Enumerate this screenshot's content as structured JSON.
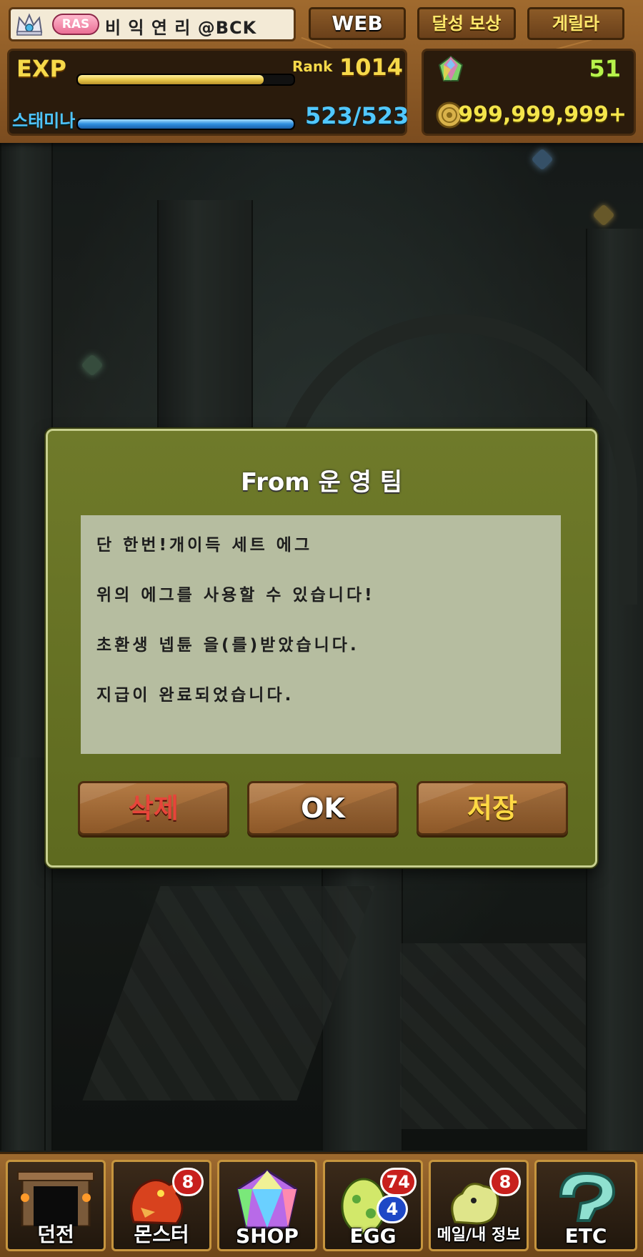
{
  "header": {
    "player_badge": "RAS",
    "player_name": "비 익 연 리 @BCK",
    "tabs": {
      "web": "WEB",
      "achievement": "달성 보상",
      "guerrilla": "게릴라"
    },
    "exp_label": "EXP",
    "exp_progress": 0.86,
    "rank_label": "Rank",
    "rank_value": "1014",
    "stamina_label": "스태미나",
    "stamina_value": "523/523",
    "stamina_progress": 1.0,
    "magic_stones": "51",
    "coins": "999,999,999+"
  },
  "dialog": {
    "title": "From 운 영 팀",
    "lines": [
      "단 한번!개이득 세트 에그",
      "위의 에그를 사용할 수 있습니다!",
      "초환생 넵튠 을(를)받았습니다.",
      "지급이 완료되었습니다."
    ],
    "buttons": {
      "delete": "삭제",
      "ok": "OK",
      "save": "저장"
    }
  },
  "nav": {
    "items": [
      {
        "label": "던전",
        "badges": []
      },
      {
        "label": "몬스터",
        "badges": [
          "8"
        ]
      },
      {
        "label": "SHOP",
        "badges": []
      },
      {
        "label": "EGG",
        "badges": [
          "74",
          "4"
        ]
      },
      {
        "label": "메일/내 정보",
        "badges": [
          "8"
        ]
      },
      {
        "label": "ETC",
        "badges": []
      }
    ]
  },
  "colors": {
    "hud_wood": "#8b5a27",
    "dialog_green": "#6f7a2a",
    "exp_bar": "#e8c84a",
    "stamina_bar": "#2f8fe0",
    "delete_text": "#e7453a",
    "save_text": "#ffd944"
  },
  "icons": [
    "crown-icon",
    "magic-stone-icon",
    "coin-icon",
    "dungeon-icon",
    "monster-icon",
    "shop-icon",
    "egg-icon",
    "mail-icon",
    "etc-icon"
  ]
}
